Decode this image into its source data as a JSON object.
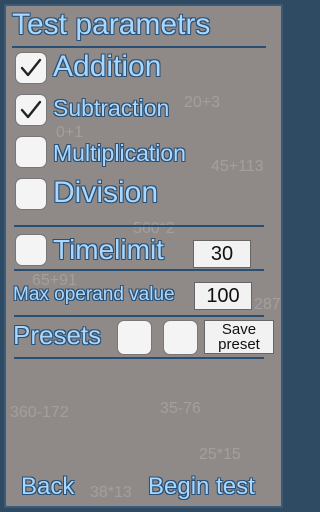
{
  "title": "Test parametrs",
  "options": [
    {
      "label": "Addition",
      "checked": true
    },
    {
      "label": "Subtraction",
      "checked": true
    },
    {
      "label": "Multiplication",
      "checked": false
    },
    {
      "label": "Division",
      "checked": false
    }
  ],
  "timelimit": {
    "label": "Timelimit",
    "checked": false,
    "value": "30"
  },
  "max_operand": {
    "label": "Max operand value",
    "value": "100"
  },
  "presets": {
    "label": "Presets",
    "save_label_line1": "Save",
    "save_label_line2": "preset"
  },
  "footer": {
    "back": "Back",
    "begin": "Begin test"
  },
  "background_expressions": [
    "20+3",
    "0+1",
    "45+113",
    "560*2",
    "65+91",
    "287",
    "360-172",
    "35-76",
    "25*15",
    "38*13"
  ],
  "colors": {
    "text": "#a8d8ff",
    "outline": "#2a4f74",
    "panel": "#8f8a87",
    "frame": "#2f4a63"
  }
}
